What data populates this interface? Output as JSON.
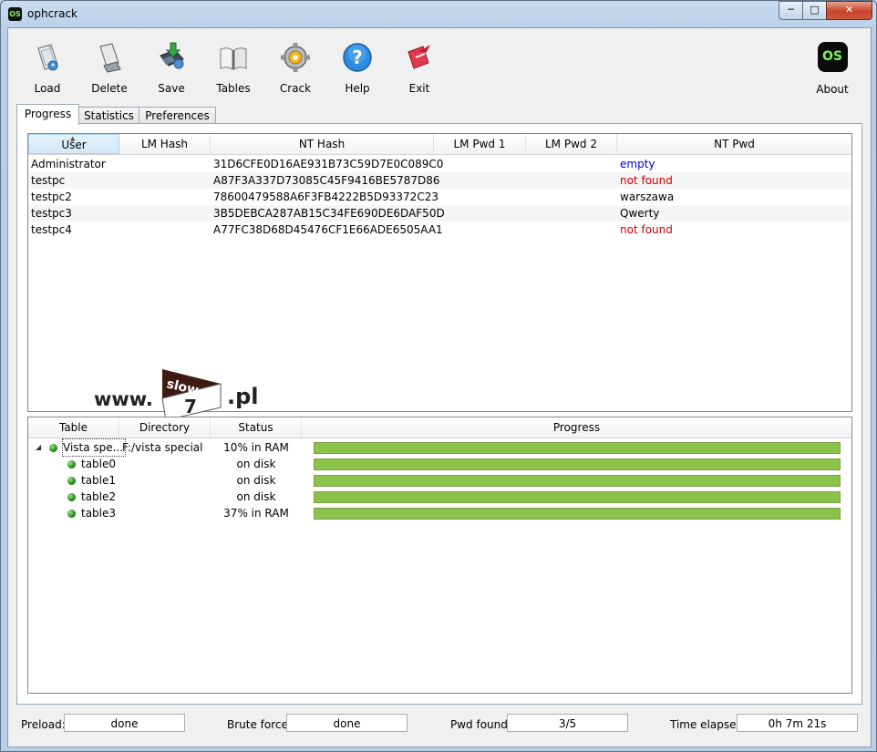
{
  "window": {
    "title": "ophcrack",
    "app_icon_text": "OS",
    "controls": [
      "minimize",
      "maximize",
      "close"
    ]
  },
  "toolbar": {
    "items": [
      {
        "label": "Load",
        "icon": "load-icon"
      },
      {
        "label": "Delete",
        "icon": "delete-icon"
      },
      {
        "label": "Save",
        "icon": "save-icon"
      },
      {
        "label": "Tables",
        "icon": "tables-icon"
      },
      {
        "label": "Crack",
        "icon": "crack-icon"
      },
      {
        "label": "Help",
        "icon": "help-icon"
      },
      {
        "label": "Exit",
        "icon": "exit-icon"
      }
    ],
    "about": {
      "label": "About",
      "icon_text": "OS"
    }
  },
  "tabs": [
    {
      "label": "Progress",
      "active": true
    },
    {
      "label": "Statistics",
      "active": false
    },
    {
      "label": "Preferences",
      "active": false
    }
  ],
  "hash_table": {
    "columns": [
      "User",
      "LM Hash",
      "NT Hash",
      "LM Pwd 1",
      "LM Pwd 2",
      "NT Pwd"
    ],
    "sorted_column": "User",
    "rows": [
      {
        "user": "Administrator",
        "lm_hash": "",
        "nt_hash": "31D6CFE0D16AE931B73C59D7E0C089C0",
        "lm_pwd1": "",
        "lm_pwd2": "",
        "nt_pwd": "empty",
        "nt_pwd_color": "#0000cc"
      },
      {
        "user": "testpc",
        "lm_hash": "",
        "nt_hash": "A87F3A337D73085C45F9416BE5787D86",
        "lm_pwd1": "",
        "lm_pwd2": "",
        "nt_pwd": "not found",
        "nt_pwd_color": "#cc0000"
      },
      {
        "user": "testpc2",
        "lm_hash": "",
        "nt_hash": "78600479588A6F3FB4222B5D93372C23",
        "lm_pwd1": "",
        "lm_pwd2": "",
        "nt_pwd": "warszawa",
        "nt_pwd_color": "#000000"
      },
      {
        "user": "testpc3",
        "lm_hash": "",
        "nt_hash": "3B5DEBCA287AB15C34FE690DE6DAF50D",
        "lm_pwd1": "",
        "lm_pwd2": "",
        "nt_pwd": "Qwerty",
        "nt_pwd_color": "#000000"
      },
      {
        "user": "testpc4",
        "lm_hash": "",
        "nt_hash": "A77FC38D68D45476CF1E66ADE6505AA1",
        "lm_pwd1": "",
        "lm_pwd2": "",
        "nt_pwd": "not found",
        "nt_pwd_color": "#cc0000"
      }
    ]
  },
  "tables_panel": {
    "columns": [
      "Table",
      "Directory",
      "Status",
      "Progress"
    ],
    "rows": [
      {
        "table": "Vista spe...",
        "directory": "F:/vista special",
        "status": "10% in RAM",
        "progress": 1.0,
        "level": 0,
        "expanded": true
      },
      {
        "table": "table0",
        "directory": "",
        "status": "on disk",
        "progress": 1.0,
        "level": 1
      },
      {
        "table": "table1",
        "directory": "",
        "status": "on disk",
        "progress": 1.0,
        "level": 1
      },
      {
        "table": "table2",
        "directory": "",
        "status": "on disk",
        "progress": 1.0,
        "level": 1
      },
      {
        "table": "table3",
        "directory": "",
        "status": "37% in RAM",
        "progress": 1.0,
        "level": 1
      }
    ],
    "bar_color": "#8bc34a"
  },
  "watermark": {
    "left": "www.",
    "logo_top": "slow",
    "logo_num": "7",
    "right": ".pl"
  },
  "status_bar": {
    "preload_label": "Preload:",
    "preload_value": "done",
    "brute_label": "Brute force:",
    "brute_value": "done",
    "pwd_label": "Pwd found:",
    "pwd_value": "3/5",
    "time_label": "Time elapsed:",
    "time_value": "0h 7m 21s"
  }
}
